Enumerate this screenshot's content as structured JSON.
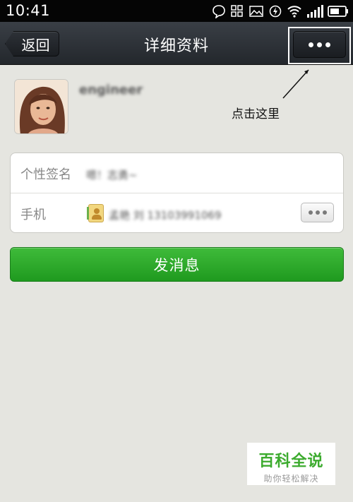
{
  "status_bar": {
    "time": "10:41",
    "icons": [
      "chat-bubble-icon",
      "grid-icon",
      "image-icon",
      "sync-icon",
      "wifi-icon",
      "signal-icon",
      "battery-icon"
    ]
  },
  "nav": {
    "back_label": "返回",
    "title": "详细资料",
    "more_icon": "more-dots-icon"
  },
  "profile": {
    "username": "engineer",
    "avatar_icon": "avatar-photo"
  },
  "annotation": {
    "text": "点击这里"
  },
  "info": {
    "signature_label": "个性签名",
    "signature_value": "嗯！志勇~",
    "phone_label": "手机",
    "phone_value": "孟艳 刘 13103991069",
    "phone_icon": "contact-book-icon",
    "phone_more_icon": "more-dots-icon"
  },
  "actions": {
    "send_message_label": "发消息"
  },
  "watermark": {
    "title": "百科全说",
    "subtitle": "助你轻松解决"
  },
  "colors": {
    "background": "#e5e5e0",
    "nav_bar": "#2b2f35",
    "send_button": "#2aa82a",
    "watermark_green": "#3cab2e"
  }
}
